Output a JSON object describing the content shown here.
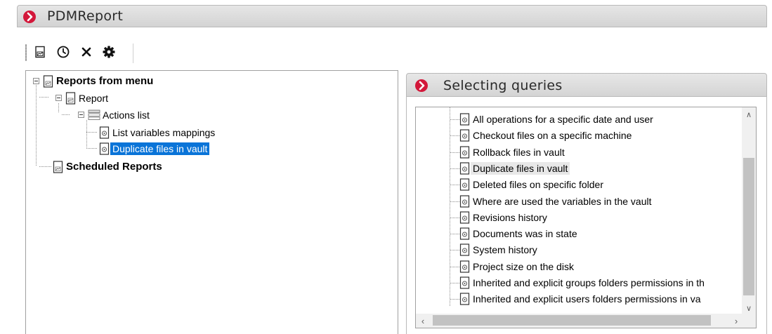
{
  "window": {
    "title": "PDMReport"
  },
  "toolbar": {
    "buttons": [
      {
        "icon": "report-icon"
      },
      {
        "icon": "clock-icon"
      },
      {
        "icon": "close-icon"
      },
      {
        "icon": "gear-icon"
      }
    ]
  },
  "tree": {
    "reports_from_menu": "Reports from menu",
    "report": "Report",
    "actions_list": "Actions list",
    "list_variables_mappings": "List variables mappings",
    "duplicate_files_in_vault": "Duplicate files in vault",
    "scheduled_reports": "Scheduled Reports"
  },
  "queries_panel": {
    "title": "Selecting queries",
    "items": [
      "All operations for a specific date and user",
      "Checkout files on a specific machine",
      "Rollback files in vault",
      "Duplicate files in vault",
      "Deleted files on specific folder",
      "Where are used the variables in the vault",
      "Revisions history",
      "Documents was in state",
      "System history",
      "Project size on the disk",
      "Inherited and explicit groups folders permissions in th",
      "Inherited and explicit users folders permissions in va"
    ],
    "highlighted_index": 3
  },
  "colors": {
    "accent_icon": "#d3173a",
    "selection": "#0a74d8"
  }
}
